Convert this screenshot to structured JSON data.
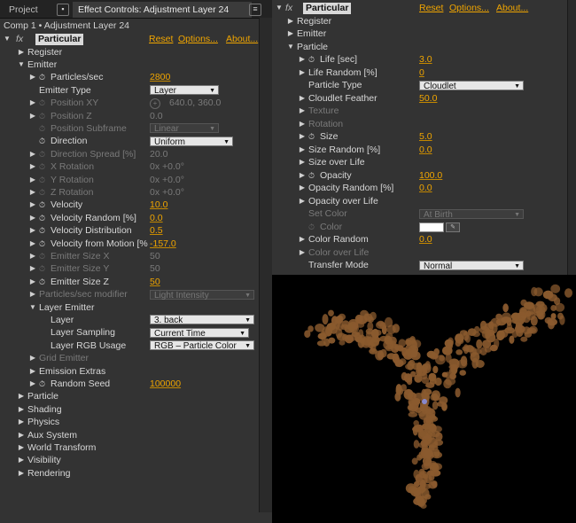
{
  "tabs": {
    "project": "Project",
    "effect_controls": "Effect Controls: Adjustment Layer 24"
  },
  "breadcrumb": "Comp 1 • Adjustment Layer 24",
  "effect": {
    "fx": "fx",
    "name": "Particular",
    "reset": "Reset",
    "options": "Options...",
    "about": "About..."
  },
  "left_rows": [
    {
      "d": 1,
      "tri": "▶",
      "label": "Register"
    },
    {
      "d": 1,
      "tri": "▼",
      "label": "Emitter"
    },
    {
      "d": 2,
      "tri": "▶",
      "sw": true,
      "label": "Particles/sec",
      "value": "2800"
    },
    {
      "d": 2,
      "label": "Emitter Type",
      "dd": "Layer",
      "ddw": 78
    },
    {
      "d": 2,
      "tri": "▶",
      "sw": true,
      "dim": true,
      "label": "Position XY",
      "pos": true,
      "value": "640.0, 360.0"
    },
    {
      "d": 2,
      "tri": "▶",
      "sw": true,
      "dim": true,
      "label": "Position Z",
      "value": "0.0"
    },
    {
      "d": 2,
      "sw": true,
      "dim": true,
      "label": "Position Subframe",
      "dd": "Linear",
      "ddw": 78
    },
    {
      "d": 2,
      "sw": true,
      "label": "Direction",
      "dd": "Uniform",
      "ddw": 94
    },
    {
      "d": 2,
      "tri": "▶",
      "sw": true,
      "dim": true,
      "label": "Direction Spread [%]",
      "value": "20.0"
    },
    {
      "d": 2,
      "tri": "▶",
      "sw": true,
      "dim": true,
      "label": "X Rotation",
      "value": "0x +0.0°"
    },
    {
      "d": 2,
      "tri": "▶",
      "sw": true,
      "dim": true,
      "label": "Y Rotation",
      "value": "0x +0.0°"
    },
    {
      "d": 2,
      "tri": "▶",
      "sw": true,
      "dim": true,
      "label": "Z Rotation",
      "value": "0x +0.0°"
    },
    {
      "d": 2,
      "tri": "▶",
      "sw": true,
      "label": "Velocity",
      "value": "10.0"
    },
    {
      "d": 2,
      "tri": "▶",
      "sw": true,
      "label": "Velocity Random [%]",
      "value": "0.0"
    },
    {
      "d": 2,
      "tri": "▶",
      "sw": true,
      "label": "Velocity Distribution",
      "value": "0.5"
    },
    {
      "d": 2,
      "tri": "▶",
      "sw": true,
      "label": "Velocity from Motion [%",
      "value": "-157.0"
    },
    {
      "d": 2,
      "tri": "▶",
      "sw": true,
      "dim": true,
      "label": "Emitter Size X",
      "value": "50"
    },
    {
      "d": 2,
      "tri": "▶",
      "sw": true,
      "dim": true,
      "label": "Emitter Size Y",
      "value": "50"
    },
    {
      "d": 2,
      "tri": "▶",
      "sw": true,
      "label": "Emitter Size Z",
      "value": "50"
    },
    {
      "d": 2,
      "tri": "▶",
      "dim": true,
      "label": "Particles/sec modifier",
      "dd": "Light Intensity",
      "ddw": 118
    },
    {
      "d": 2,
      "tri": "▼",
      "label": "Layer Emitter"
    },
    {
      "d": 3,
      "label": "Layer",
      "dd": "3. back",
      "ddw": 118
    },
    {
      "d": 3,
      "label": "Layer Sampling",
      "dd": "Current Time",
      "ddw": 112
    },
    {
      "d": 3,
      "label": "Layer RGB Usage",
      "dd": "RGB – Particle Color",
      "ddw": 118
    },
    {
      "d": 2,
      "tri": "▶",
      "dim": true,
      "label": "Grid Emitter"
    },
    {
      "d": 2,
      "tri": "▶",
      "label": "Emission Extras"
    },
    {
      "d": 2,
      "tri": "▶",
      "sw": true,
      "label": "Random Seed",
      "value": "100000"
    },
    {
      "d": 1,
      "tri": "▶",
      "label": "Particle"
    },
    {
      "d": 1,
      "tri": "▶",
      "label": "Shading"
    },
    {
      "d": 1,
      "tri": "▶",
      "label": "Physics"
    },
    {
      "d": 1,
      "tri": "▶",
      "label": "Aux System"
    },
    {
      "d": 1,
      "tri": "▶",
      "label": "World Transform"
    },
    {
      "d": 1,
      "tri": "▶",
      "label": "Visibility"
    },
    {
      "d": 1,
      "tri": "▶",
      "label": "Rendering"
    }
  ],
  "right_rows": [
    {
      "d": 1,
      "tri": "▶",
      "label": "Register"
    },
    {
      "d": 1,
      "tri": "▶",
      "label": "Emitter"
    },
    {
      "d": 1,
      "tri": "▼",
      "label": "Particle"
    },
    {
      "d": 2,
      "tri": "▶",
      "sw": true,
      "label": "Life [sec]",
      "value": "3.0"
    },
    {
      "d": 2,
      "tri": "▶",
      "label": "Life Random [%]",
      "value": "0"
    },
    {
      "d": 2,
      "label": "Particle Type",
      "dd": "Cloudlet",
      "ddw": 118
    },
    {
      "d": 2,
      "tri": "▶",
      "label": "Cloudlet Feather",
      "value": "50.0"
    },
    {
      "d": 2,
      "tri": "▶",
      "dim": true,
      "label": "Texture"
    },
    {
      "d": 2,
      "tri": "▶",
      "dim": true,
      "label": "Rotation"
    },
    {
      "d": 2,
      "tri": "▶",
      "sw": true,
      "label": "Size",
      "value": "5.0"
    },
    {
      "d": 2,
      "tri": "▶",
      "label": "Size Random [%]",
      "value": "0.0"
    },
    {
      "d": 2,
      "tri": "▶",
      "label": "Size over Life"
    },
    {
      "d": 2,
      "tri": "▶",
      "sw": true,
      "label": "Opacity",
      "value": "100.0"
    },
    {
      "d": 2,
      "tri": "▶",
      "label": "Opacity Random [%]",
      "value": "0.0"
    },
    {
      "d": 2,
      "tri": "▶",
      "label": "Opacity over Life"
    },
    {
      "d": 2,
      "dim": true,
      "label": "Set Color",
      "dd": "At Birth",
      "ddw": 118
    },
    {
      "d": 2,
      "sw": true,
      "dim": true,
      "label": "Color",
      "color": "#ffffff"
    },
    {
      "d": 2,
      "tri": "▶",
      "label": "Color Random",
      "value": "0.0"
    },
    {
      "d": 2,
      "tri": "▶",
      "dim": true,
      "label": "Color over Life"
    },
    {
      "d": 2,
      "label": "Transfer Mode",
      "dd": "Normal",
      "ddw": 118
    }
  ],
  "colors": {
    "accent": "#f0a500",
    "panel": "#333333",
    "particle": "#8a5a2e"
  }
}
